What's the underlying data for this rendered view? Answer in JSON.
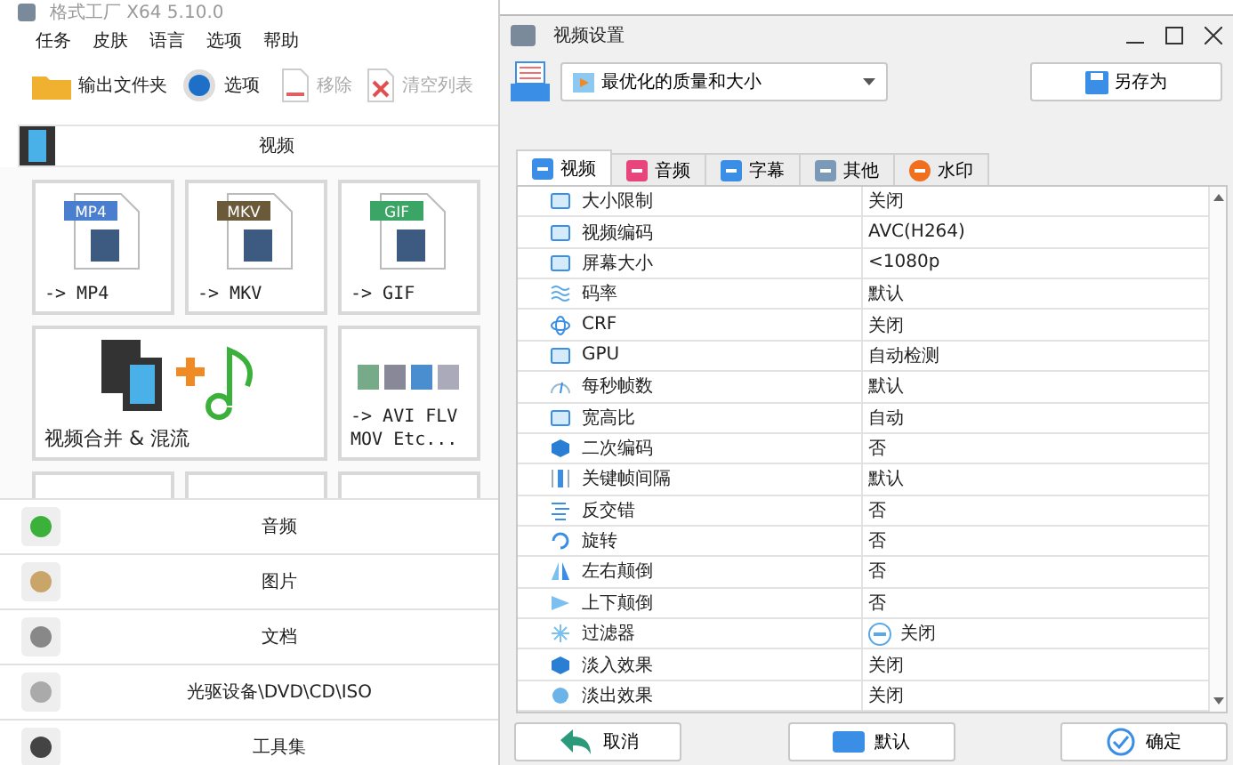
{
  "main_window": {
    "title": "格式工厂 X64 5.10.0",
    "menu": [
      "任务",
      "皮肤",
      "语言",
      "选项",
      "帮助"
    ],
    "toolbar": [
      {
        "label": "输出文件夹",
        "disabled": false
      },
      {
        "label": "选项",
        "disabled": false
      },
      {
        "label": "移除",
        "disabled": true
      },
      {
        "label": "清空列表",
        "disabled": true
      }
    ],
    "video_header": "视频",
    "tiles": [
      {
        "kind": "file",
        "badge": "MP4",
        "color": "#4a7fd0",
        "lines": [
          "-> MP4"
        ]
      },
      {
        "kind": "file",
        "badge": "MKV",
        "color": "#6b5a3a",
        "lines": [
          "-> MKV"
        ]
      },
      {
        "kind": "file",
        "badge": "GIF",
        "color": "#3aa564",
        "lines": [
          "-> GIF"
        ]
      },
      {
        "kind": "merge",
        "lines": [
          "视频合并 & 混流"
        ]
      },
      {
        "kind": "multi",
        "lines": [
          "-> AVI FLV",
          "MOV Etc..."
        ]
      },
      {
        "kind": "partial"
      },
      {
        "kind": "partial"
      },
      {
        "kind": "partial"
      }
    ],
    "categories": [
      "音频",
      "图片",
      "文档",
      "光驱设备\\DVD\\CD\\ISO",
      "工具集"
    ]
  },
  "settings_window": {
    "title": "视频设置",
    "preset": "最优化的质量和大小",
    "save_as": "另存为",
    "tabs": [
      {
        "label": "视频",
        "selected": true
      },
      {
        "label": "音频",
        "selected": false
      },
      {
        "label": "字幕",
        "selected": false
      },
      {
        "label": "其他",
        "selected": false
      },
      {
        "label": "水印",
        "selected": false
      }
    ],
    "rows": [
      {
        "name": "大小限制",
        "value": "关闭",
        "kind": "text"
      },
      {
        "name": "视频编码",
        "value": "AVC(H264)",
        "kind": "text"
      },
      {
        "name": "屏幕大小",
        "value": "<1080p",
        "kind": "text"
      },
      {
        "name": "码率",
        "value": "默认",
        "kind": "text"
      },
      {
        "name": "CRF",
        "value": "关闭",
        "kind": "text"
      },
      {
        "name": "GPU",
        "value": "自动检测",
        "kind": "text"
      },
      {
        "name": "每秒帧数",
        "value": "默认",
        "kind": "text"
      },
      {
        "name": "宽高比",
        "value": "自动",
        "kind": "text"
      },
      {
        "name": "二次编码",
        "value": "否",
        "kind": "text"
      },
      {
        "name": "关键帧间隔",
        "value": "默认",
        "kind": "text"
      },
      {
        "name": "反交错",
        "value": "否",
        "kind": "text"
      },
      {
        "name": "旋转",
        "value": "否",
        "kind": "text"
      },
      {
        "name": "左右颠倒",
        "value": "否",
        "kind": "text"
      },
      {
        "name": "上下颠倒",
        "value": "否",
        "kind": "text"
      },
      {
        "name": "过滤器",
        "value": "关闭",
        "kind": "toggle"
      },
      {
        "name": "淡入效果",
        "value": "关闭",
        "kind": "text"
      },
      {
        "name": "淡出效果",
        "value": "关闭",
        "kind": "text"
      }
    ],
    "buttons": [
      "取消",
      "默认",
      "确定"
    ]
  }
}
